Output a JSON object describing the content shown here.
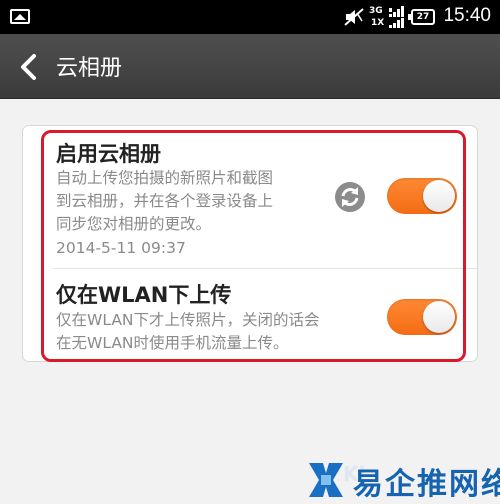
{
  "status_bar": {
    "network_type_top": "3G",
    "network_type_bottom": "1X",
    "battery_level": "27",
    "time": "15:40",
    "icons": [
      "gallery-icon",
      "mute-icon",
      "signal-icon",
      "battery-icon"
    ]
  },
  "header": {
    "title": "云相册"
  },
  "settings": [
    {
      "title": "启用云相册",
      "description_lines": [
        "自动上传您拍摄的新照片和截图",
        "到云相册，并在各个登录设备上",
        "同步您对相册的更改。"
      ],
      "timestamp": "2014-5-11 09:37",
      "enabled": true
    },
    {
      "title": "仅在WLAN下上传",
      "description_lines": [
        "仅在WLAN下才上传照片，关闭的话会",
        "在无WLAN时使用手机流量上传。"
      ],
      "enabled": true
    }
  ],
  "watermark": {
    "text": "易企推网络",
    "faint_text": "Kl"
  },
  "colors": {
    "toggle_on": "#f36c14",
    "highlight_border": "#d81a2a",
    "action_bar": "#444444"
  }
}
